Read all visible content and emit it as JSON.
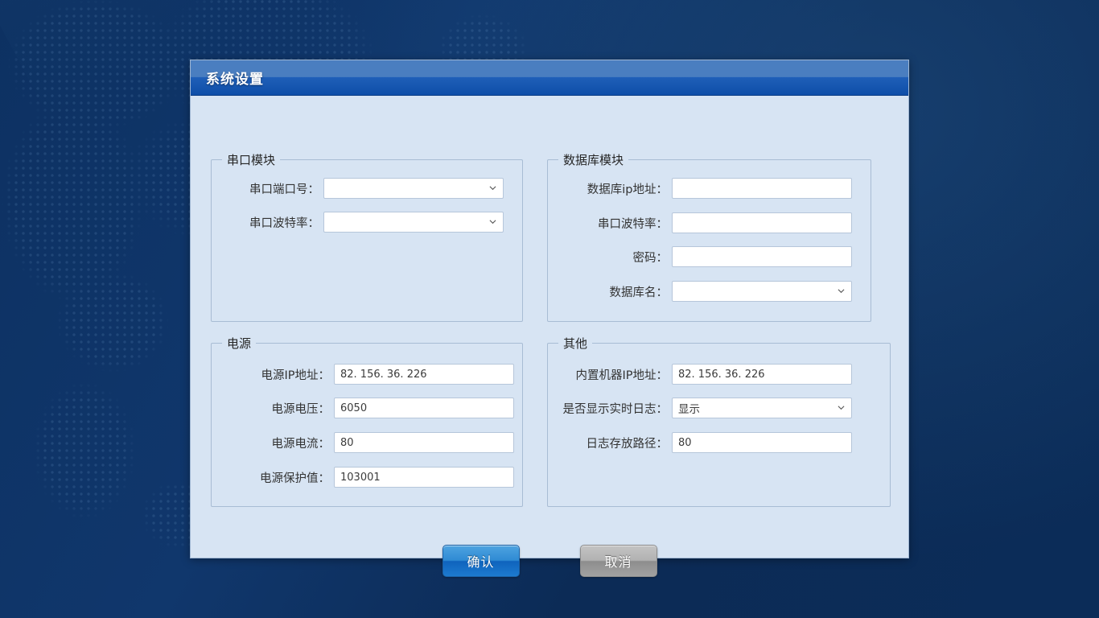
{
  "dialog": {
    "title": "系统设置"
  },
  "groups": {
    "serial": {
      "legend": "串口模块",
      "rows": [
        {
          "label": "串口端口号：",
          "value": "",
          "type": "combo"
        },
        {
          "label": "串口波特率：",
          "value": "",
          "type": "combo"
        }
      ]
    },
    "database": {
      "legend": "数据库模块",
      "rows": [
        {
          "label": "数据库ip地址：",
          "value": "",
          "type": "text"
        },
        {
          "label": "串口波特率：",
          "value": "",
          "type": "text"
        },
        {
          "label": "密码：",
          "value": "",
          "type": "text"
        },
        {
          "label": "数据库名：",
          "value": "",
          "type": "combo"
        }
      ]
    },
    "power": {
      "legend": "电源",
      "rows": [
        {
          "label": "电源IP地址：",
          "value": "82. 156. 36. 226",
          "type": "text"
        },
        {
          "label": "电源电压：",
          "value": "6050",
          "type": "text"
        },
        {
          "label": "电源电流：",
          "value": "80",
          "type": "text"
        },
        {
          "label": "电源保护值：",
          "value": "103001",
          "type": "text"
        }
      ]
    },
    "other": {
      "legend": "其他",
      "rows": [
        {
          "label": "内置机器IP地址：",
          "value": "82. 156. 36. 226",
          "type": "text"
        },
        {
          "label": "是否显示实时日志：",
          "value": "显示",
          "type": "combo"
        },
        {
          "label": "日志存放路径：",
          "value": "80",
          "type": "text"
        }
      ]
    }
  },
  "buttons": {
    "ok": "确认",
    "cancel": "取消"
  },
  "icons": {
    "chevron": "chevron-down-icon"
  },
  "colors": {
    "desktop": "#0e3364",
    "titlebar_top": "#4a7ec0",
    "titlebar_bottom": "#0e4ea8",
    "dialog_bg": "#d7e4f3",
    "group_border": "#a8bcd4",
    "field_border": "#b6c6da",
    "ok_button": "#2f8bd4",
    "cancel_button": "#a2a2a2"
  }
}
